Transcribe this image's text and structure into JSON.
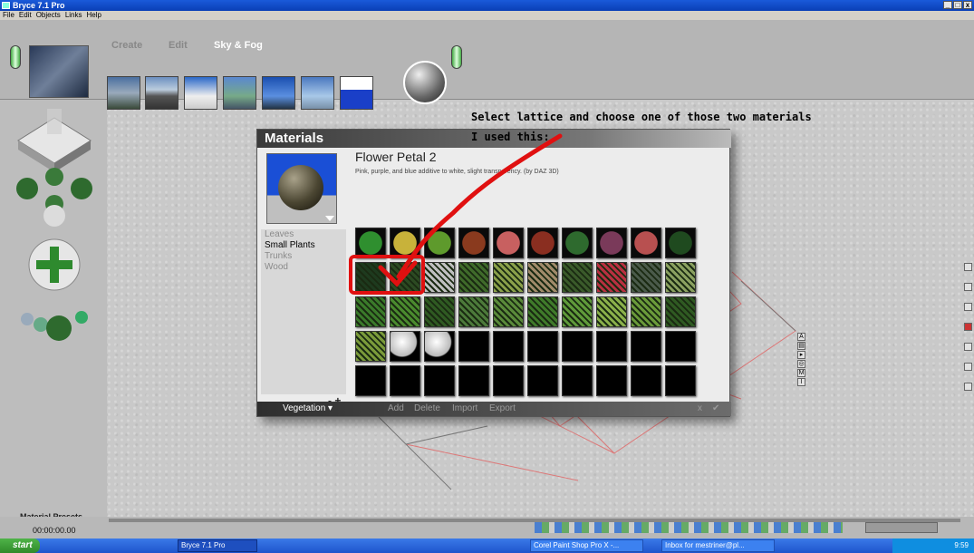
{
  "window": {
    "title": "Bryce 7.1 Pro",
    "buttons": [
      "_",
      "□",
      "x"
    ]
  },
  "menu": [
    "File",
    "Edit",
    "Objects",
    "Links",
    "Help"
  ],
  "mode_tabs": [
    {
      "label": "Create"
    },
    {
      "label": "Edit"
    },
    {
      "label": "Sky & Fog",
      "active": true
    }
  ],
  "dialog": {
    "title": "Materials",
    "material_name": "Flower Petal 2",
    "material_description": "Pink, purple, and blue additive to white, slight transparency. (by DAZ 3D)",
    "categories": [
      "Leaves",
      "Small Plants",
      "Trunks",
      "Wood"
    ],
    "selected_category": "Small Plants",
    "minus": "-",
    "plus": "+",
    "library": "Vegetation",
    "footer_actions": [
      "Add",
      "Delete",
      "Import",
      "Export"
    ],
    "cancel": "x",
    "ok": "✔"
  },
  "swatches": [
    "#2f8f2f",
    "#c8b23a",
    "#5e9a2c",
    "#8a3a1e",
    "#c86060",
    "#8a2e20",
    "#2e6a2e",
    "#7a3a5a",
    "#b85050",
    "#1f4a1f",
    "#1e3a1e",
    "#2c4a22",
    "#bfbfbf",
    "#3f6a2a",
    "#8aa04a",
    "#a08a6a",
    "#3a5a2a",
    "#b83040",
    "#4a5a4a",
    "#8aa060",
    "#3a7a2a",
    "#4a8a2e",
    "#2f5a22",
    "#4c7a3a",
    "#5a8a3a",
    "#3f7a2a",
    "#5f9a3a",
    "#8ab04a",
    "#6a9a3a",
    "#2f5a22",
    "#7a9a3a",
    "#e8e8e8",
    "#e8e8e8",
    "#000000",
    "#000000",
    "#000000",
    "#000000",
    "#000000",
    "#000000",
    "#000000",
    "#000000",
    "#000000",
    "#000000",
    "#000000",
    "#000000",
    "#000000",
    "#000000",
    "#000000",
    "#000000",
    "#000000"
  ],
  "annotation": {
    "line1": "Select lattice and choose one of those two materials",
    "line2": "I used this:",
    "color": "#e01010"
  },
  "bottom_left": {
    "label": "Material Presets...",
    "time": "00:00:00.00"
  },
  "right_letters": [
    "A",
    "▤",
    "▸",
    "◎",
    "M",
    "I"
  ],
  "taskbar": {
    "start": "start",
    "items": [
      "Bryce 7.1 Pro",
      "Corel Paint Shop Pro X -...",
      "Inbox for mestriner@pl..."
    ],
    "clock": "9:59"
  },
  "colors": {
    "accent": "#1a5ad9",
    "dialog_bg": "#ececec"
  }
}
